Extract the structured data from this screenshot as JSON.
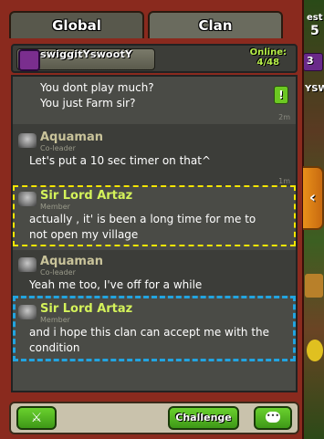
{
  "tabs": {
    "global": "Global",
    "clan": "Clan"
  },
  "clan_bar": {
    "name": "swiggitYswootY",
    "online_label": "Online:",
    "online_count": "4/48"
  },
  "side": {
    "top_label": "est",
    "top_value": "5",
    "label2": "3",
    "label3": "YSW",
    "collapse_glyph": "‹"
  },
  "messages": [
    {
      "sender": "",
      "role": "",
      "lines": [
        "You dont play much?",
        "You just Farm sir?"
      ],
      "time": "2m",
      "alert": "!"
    },
    {
      "sender": "Aquaman",
      "role": "Co-leader",
      "lines": [
        "Let's put a 10 sec timer on that^"
      ],
      "time": "1m"
    },
    {
      "sender": "Sir Lord Artaz",
      "role": "Member",
      "lines": [
        "actually , it' is been a long time for me to",
        "not open my village"
      ]
    },
    {
      "sender": "Aquaman",
      "role": "Co-leader",
      "lines": [
        "Yeah me too, I've off for a while"
      ]
    },
    {
      "sender": "Sir Lord Artaz",
      "role": "Member",
      "lines": [
        "and i hope this clan can accept me with the",
        "condition"
      ]
    }
  ],
  "bottom": {
    "challenge_label": "Challenge",
    "chat_glyph": "•••"
  },
  "colors": {
    "panel": "#8a2a1e",
    "chat_bg": "#4a4b46",
    "highlight_yellow": "#f4e600",
    "highlight_blue": "#22a4e0",
    "button_green": "#4fb41f"
  }
}
